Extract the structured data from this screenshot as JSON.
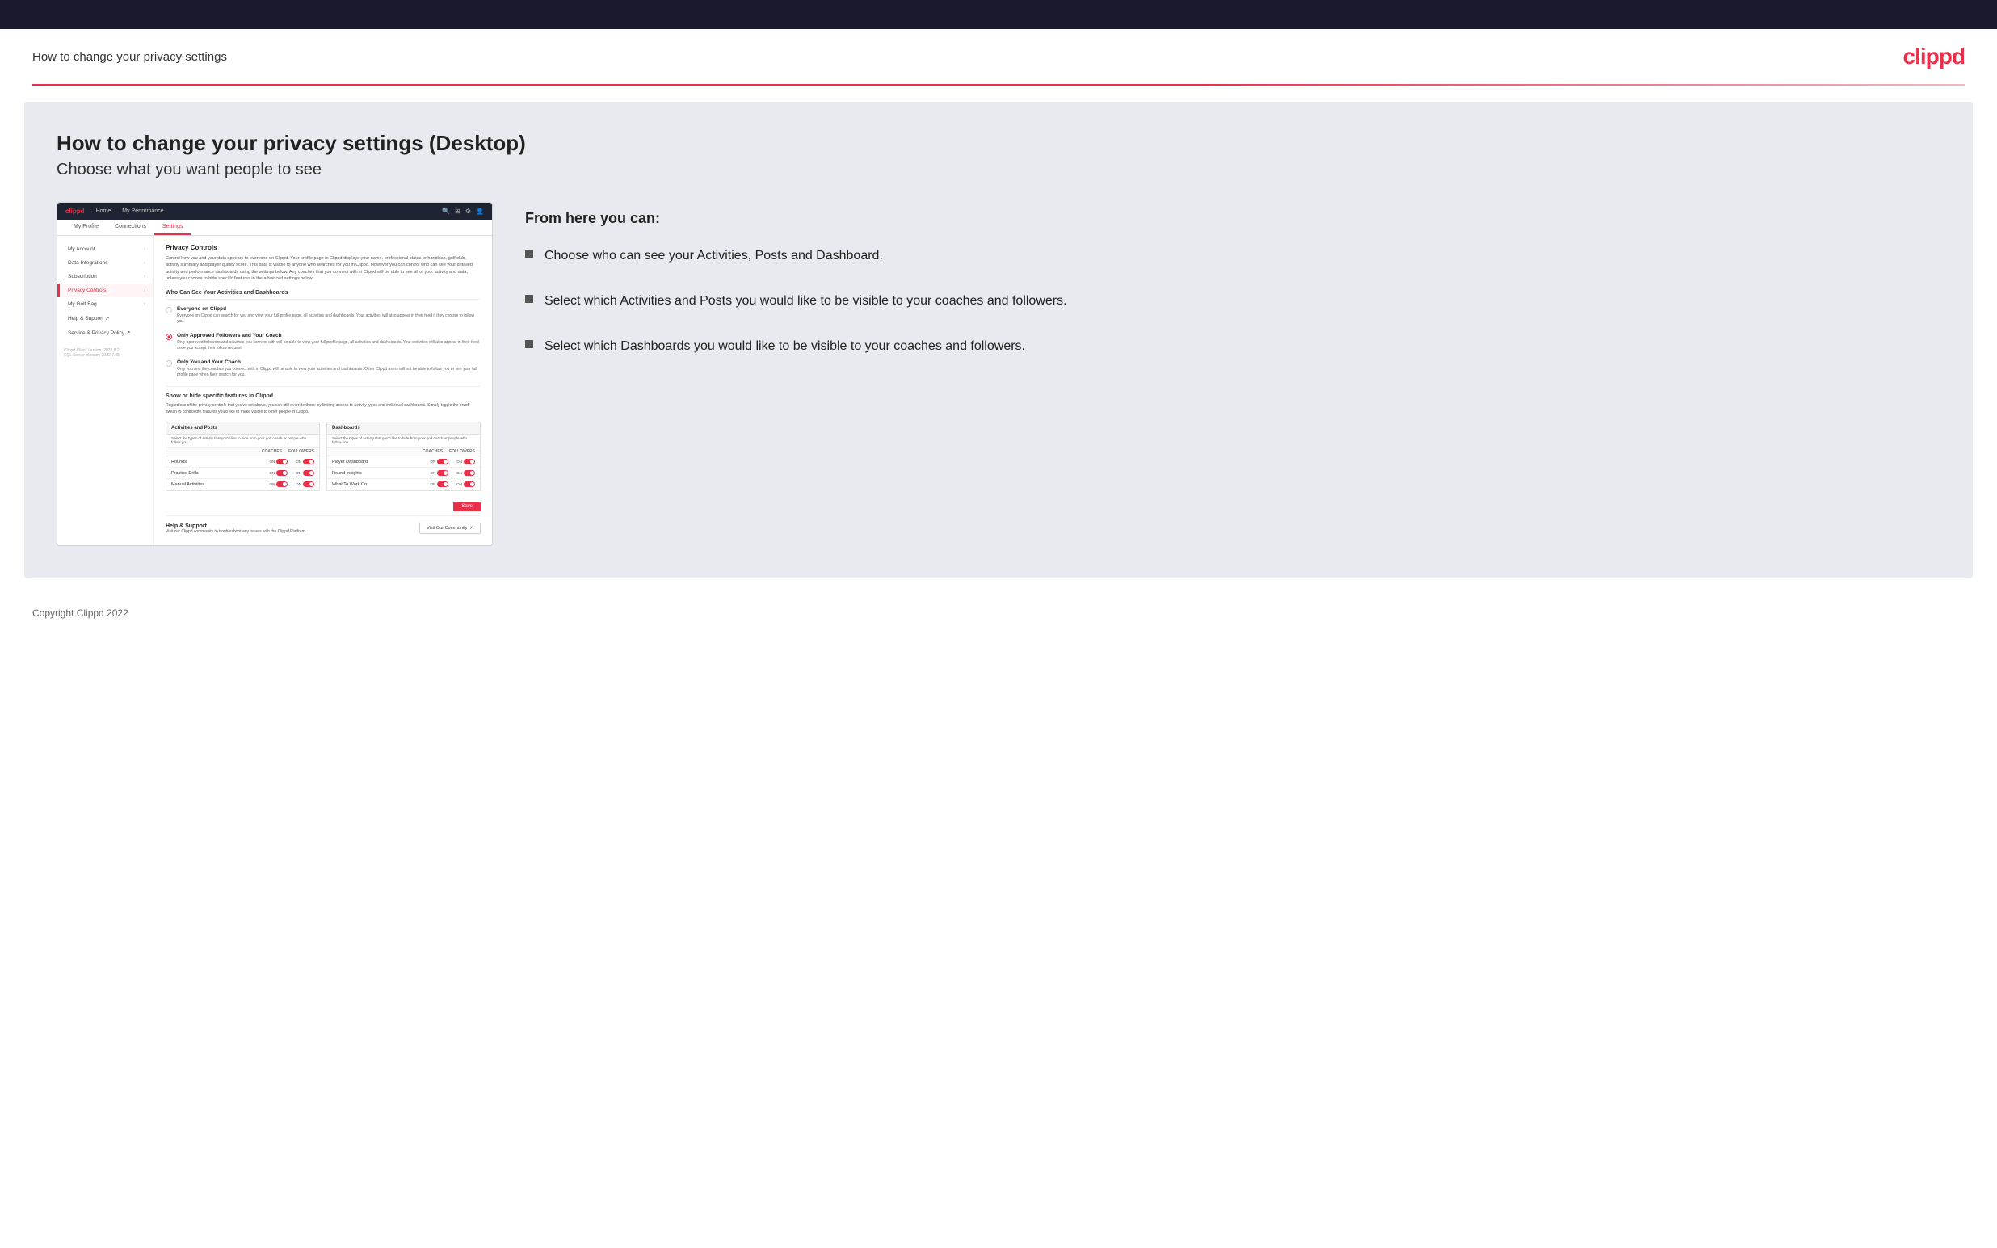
{
  "header": {
    "title": "How to change your privacy settings",
    "logo": "clippd"
  },
  "main": {
    "heading": "How to change your privacy settings (Desktop)",
    "subheading": "Choose what you want people to see",
    "right_panel": {
      "from_here": "From here you can:",
      "bullets": [
        "Choose who can see your Activities, Posts and Dashboard.",
        "Select which Activities and Posts you would like to be visible to your coaches and followers.",
        "Select which Dashboards you would like to be visible to your coaches and followers."
      ]
    }
  },
  "mockup": {
    "nav": {
      "logo": "clippd",
      "links": [
        "Home",
        "My Performance"
      ]
    },
    "tabs": [
      "My Profile",
      "Connections",
      "Settings"
    ],
    "sidebar": {
      "items": [
        {
          "label": "My Account",
          "active": false
        },
        {
          "label": "Data Integrations",
          "active": false
        },
        {
          "label": "Subscription",
          "active": false
        },
        {
          "label": "Privacy Controls",
          "active": true
        },
        {
          "label": "My Golf Bag",
          "active": false
        },
        {
          "label": "Help & Support",
          "active": false
        },
        {
          "label": "Service & Privacy Policy",
          "active": false
        }
      ],
      "version": "Clippd Client Version: 2022.8.2\nSQL Server Version: 2022.7.35"
    },
    "privacy_controls": {
      "section_title": "Privacy Controls",
      "section_desc": "Control how you and your data appears to everyone on Clippd. Your profile page in Clippd displays your name, professional status or handicap, golf club, activity summary and player quality score. This data is visible to anyone who searches for you in Clippd. However you can control who can see your detailed activity and performance dashboards using the settings below. Any coaches that you connect with in Clippd will be able to see all of your activity and data, unless you choose to hide specific features in the advanced settings below.",
      "who_title": "Who Can See Your Activities and Dashboards",
      "options": [
        {
          "label": "Everyone on Clippd",
          "desc": "Everyone on Clippd can search for you and view your full profile page, all activities and dashboards. Your activities will also appear in their feed if they choose to follow you.",
          "selected": false
        },
        {
          "label": "Only Approved Followers and Your Coach",
          "desc": "Only approved followers and coaches you connect with will be able to view your full profile page, all activities and dashboards. Your activities will also appear in their feed once you accept their follow request.",
          "selected": true
        },
        {
          "label": "Only You and Your Coach",
          "desc": "Only you and the coaches you connect with in Clippd will be able to view your activities and dashboards. Other Clippd users will not be able to follow you or see your full profile page when they search for you.",
          "selected": false
        }
      ],
      "show_hide_title": "Show or hide specific features in Clippd",
      "show_hide_desc": "Regardless of the privacy controls that you've set above, you can still override these by limiting access to activity types and individual dashboards. Simply toggle the on/off switch to control the features you'd like to make visible to other people in Clippd.",
      "activities_table": {
        "title": "Activities and Posts",
        "desc": "Select the types of activity that you'd like to hide from your golf coach or people who follow you.",
        "cols": [
          "COACHES",
          "FOLLOWERS"
        ],
        "rows": [
          {
            "label": "Rounds",
            "coaches": "ON",
            "followers": "ON"
          },
          {
            "label": "Practice Drills",
            "coaches": "ON",
            "followers": "ON"
          },
          {
            "label": "Manual Activities",
            "coaches": "ON",
            "followers": "ON"
          }
        ]
      },
      "dashboards_table": {
        "title": "Dashboards",
        "desc": "Select the types of activity that you'd like to hide from your golf coach or people who follow you.",
        "cols": [
          "COACHES",
          "FOLLOWERS"
        ],
        "rows": [
          {
            "label": "Player Dashboard",
            "coaches": "ON",
            "followers": "ON"
          },
          {
            "label": "Round Insights",
            "coaches": "ON",
            "followers": "ON"
          },
          {
            "label": "What To Work On",
            "coaches": "ON",
            "followers": "ON"
          }
        ]
      },
      "save_btn": "Save",
      "help": {
        "title": "Help & Support",
        "desc": "Visit our Clippd community to troubleshoot any issues with the Clippd Platform.",
        "btn": "Visit Our Community"
      }
    }
  },
  "footer": {
    "copyright": "Copyright Clippd 2022"
  }
}
